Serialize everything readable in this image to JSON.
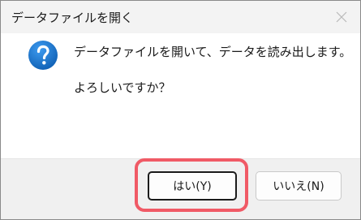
{
  "dialog": {
    "title": "データファイルを開く",
    "message_line1": "データファイルを開いて、データを読み出します。",
    "message_line2": "よろしいですか？",
    "icon": "question-icon",
    "buttons": {
      "yes_label": "はい(Y)",
      "no_label": "いいえ(N)"
    }
  },
  "colors": {
    "title_bar": "#f3f3f3",
    "footer": "#f0f0f0",
    "icon_blue": "#1a73c8",
    "highlight": "#f05a66"
  }
}
